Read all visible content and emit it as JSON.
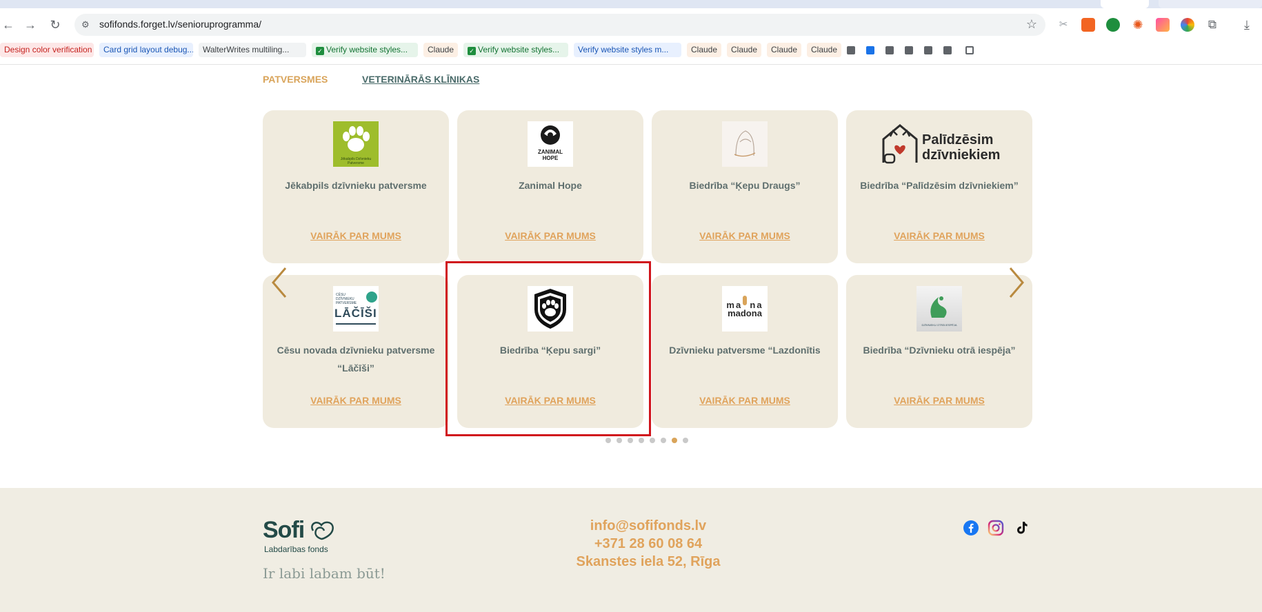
{
  "browser": {
    "url": "sofifonds.forget.lv/senioruprogramma/",
    "bookmarks": [
      {
        "label": "Design color verification",
        "checked": false,
        "bg": "#fde7e7",
        "color": "#c5221f"
      },
      {
        "label": "Card grid layout debug...",
        "checked": false,
        "bg": "#e8f0fe",
        "color": "#1a56b5"
      },
      {
        "label": "WalterWrites multiling...",
        "checked": false,
        "bg": "#f1f3f4",
        "color": "#3c4043"
      },
      {
        "label": "Verify website styles...",
        "checked": true,
        "bg": "#e6f4ea",
        "color": "#137333"
      },
      {
        "label": "Claude",
        "checked": false,
        "bg": "#fcefe4",
        "color": "#3c4043"
      },
      {
        "label": "Verify website styles...",
        "checked": true,
        "bg": "#e6f4ea",
        "color": "#137333"
      },
      {
        "label": "Verify website styles m...",
        "checked": false,
        "bg": "#e8f0fe",
        "color": "#1a56b5"
      },
      {
        "label": "Claude",
        "checked": false,
        "bg": "#fcefe4",
        "color": "#3c4043"
      },
      {
        "label": "Claude",
        "checked": false,
        "bg": "#fcefe4",
        "color": "#3c4043"
      },
      {
        "label": "Claude",
        "checked": false,
        "bg": "#fcefe4",
        "color": "#3c4043"
      },
      {
        "label": "Claude",
        "checked": false,
        "bg": "#fcefe4",
        "color": "#3c4043"
      }
    ]
  },
  "tabs": [
    {
      "label": "PATVERSMES",
      "active": true
    },
    {
      "label": "VETERINĀRĀS KLĪNIKAS",
      "active": false
    }
  ],
  "cards": [
    {
      "name": "Jēkabpils dzīvnieku patversme",
      "more": "VAIRĀK PAR MUMS",
      "logo": "jekabpils-paw-logo"
    },
    {
      "name": "Zanimal Hope",
      "more": "VAIRĀK PAR MUMS",
      "logo": "zanimal-hope-logo"
    },
    {
      "name": "Biedrība “Ķepu Draugs”",
      "more": "VAIRĀK PAR MUMS",
      "logo": "kepu-draugs-logo"
    },
    {
      "name": "Biedrība “Palīdzēsim dzīvniekiem”",
      "more": "VAIRĀK PAR MUMS",
      "logo": "palidzesim-logo"
    },
    {
      "name": "Cēsu novada dzīvnieku patversme “Lāčīši”",
      "more": "VAIRĀK PAR MUMS",
      "logo": "lacisi-logo"
    },
    {
      "name": "Biedrība “Ķepu sargi”",
      "more": "VAIRĀK PAR MUMS",
      "logo": "kepu-sargi-logo"
    },
    {
      "name": "Dzīvnieku patversme “Lazdonītis",
      "more": "VAIRĀK PAR MUMS",
      "logo": "madona-logo"
    },
    {
      "name": "Biedrība “Dzīvnieku otrā iespēja”",
      "more": "VAIRĀK PAR MUMS",
      "logo": "otra-iespeja-logo"
    }
  ],
  "logos": {
    "palidzesim_line1": "Palīdzēsim",
    "palidzesim_line2": "dzīvniekiem",
    "zanimal_line1": "ZANIMAL",
    "zanimal_line2": "HOPE",
    "jekabpils_caption": "Jēkabpils Dzīvnieku Patversme",
    "lacisi_caption": "CĒSU DZĪVNIEKU PATVERSME",
    "lacisi_word": "LĀČĪŠI",
    "madona_word": "madona",
    "otra_caption": "DZĪVNIEKU OTRĀ IESPĒJA"
  },
  "pagination": {
    "count": 8,
    "active_index": 6
  },
  "footer": {
    "brand": "Sofi",
    "brand_sub": "Labdarības fonds",
    "tagline": "Ir labi labam būt!",
    "email": "info@sofifonds.lv",
    "phone": "+371 28 60 08 64",
    "address": "Skanstes iela 52, Rīga"
  },
  "colors": {
    "accent": "#e0a35c",
    "card_bg": "#f0ebde",
    "highlight": "#d0141c",
    "brand": "#234a47"
  }
}
